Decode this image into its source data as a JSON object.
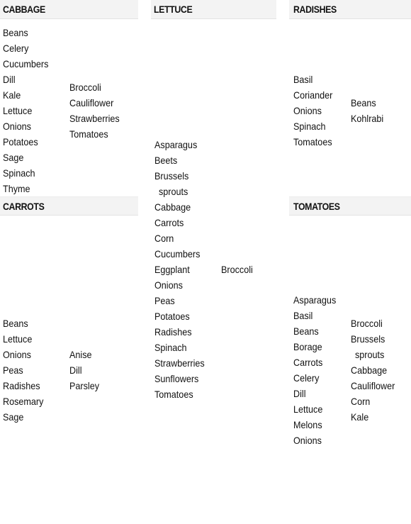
{
  "cards": {
    "cabbage": {
      "title": "CABBAGE",
      "left": [
        "Beans",
        "Celery",
        "Cucumbers",
        "Dill",
        "Kale",
        "Lettuce",
        "Onions",
        "Potatoes",
        "Sage",
        "Spinach",
        "Thyme"
      ],
      "right": [
        "Broccoli",
        "Cauliflower",
        "Strawberries",
        "Tomatoes"
      ]
    },
    "lettuce": {
      "title": "LETTUCE",
      "left": [
        "Asparagus",
        "Beets",
        "Brussels",
        "sprouts",
        "Cabbage",
        "Carrots",
        "Corn",
        "Cucumbers",
        "Eggplant",
        "Onions",
        "Peas",
        "Potatoes",
        "Radishes",
        "Spinach",
        "Strawberries",
        "Sunflowers",
        "Tomatoes"
      ],
      "right": [
        "Broccoli"
      ]
    },
    "radishes": {
      "title": "RADISHES",
      "left": [
        "Basil",
        "Coriander",
        "Onions",
        "Spinach",
        "Tomatoes"
      ],
      "right": [
        "Beans",
        "Kohlrabi"
      ]
    },
    "carrots": {
      "title": "CARROTS",
      "left": [
        "Beans",
        "Lettuce",
        "Onions",
        "Peas",
        "Radishes",
        "Rosemary",
        "Sage"
      ],
      "right": [
        "Anise",
        "Dill",
        "Parsley"
      ]
    },
    "tomatoes": {
      "title": "TOMATOES",
      "left": [
        "Asparagus",
        "Basil",
        "Beans",
        "Borage",
        "Carrots",
        "Celery",
        "Dill",
        "Lettuce",
        "Melons",
        "Onions"
      ],
      "right": [
        "Broccoli",
        "Brussels",
        "sprouts",
        "Cabbage",
        "Cauliflower",
        "Corn",
        "Kale"
      ]
    }
  }
}
